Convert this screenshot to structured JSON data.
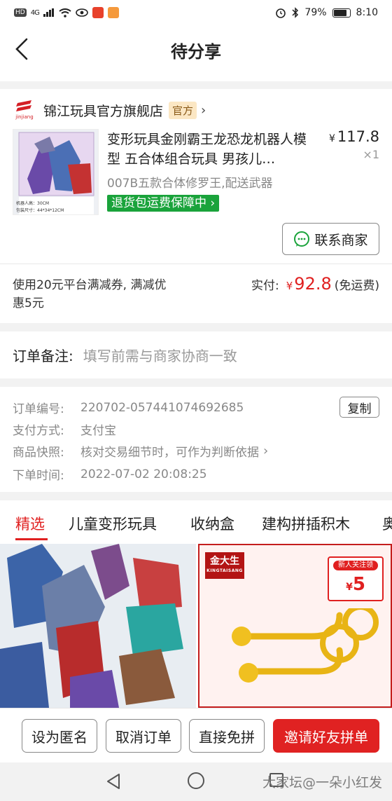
{
  "status_bar": {
    "hd": "HD",
    "network": "4G",
    "battery": "79%",
    "time": "8:10"
  },
  "nav": {
    "title": "待分享"
  },
  "store": {
    "logo_text": "jinjiang",
    "name": "锦江玩具官方旗舰店",
    "badge": "官方"
  },
  "product": {
    "name": "变形玩具金刚霸王龙恐龙机器人模型 五合体组合玩具 男孩儿…",
    "price_symbol": "¥",
    "price": "117.8",
    "quantity": "×1",
    "spec": "007B五款合体修罗王,配送武器",
    "guarantee": "退货包运费保障中",
    "image_caption_1": "机器人高：30CM",
    "image_caption_2": "包装尺寸：44*34*12CM"
  },
  "contact": {
    "label": "联系商家"
  },
  "payment": {
    "coupon_text": "使用20元平台满减券, 满减优惠5元",
    "paid_label": "实付:",
    "currency": "¥",
    "paid_amount": "92.8",
    "shipping": "(免运费)"
  },
  "remark": {
    "label": "订单备注:",
    "placeholder": "填写前需与商家协商一致"
  },
  "order_info": {
    "order_no_label": "订单编号:",
    "order_no": "220702-057441074692685",
    "copy_label": "复制",
    "pay_method_label": "支付方式:",
    "pay_method": "支付宝",
    "snapshot_label": "商品快照:",
    "snapshot_value": "核对交易细节时，可作为判断依据",
    "time_label": "下单时间:",
    "time_value": "2022-07-02 20:08:25"
  },
  "tabs": [
    {
      "label": "精选",
      "active": true
    },
    {
      "label": "儿童变形玩具",
      "active": false
    },
    {
      "label": "收纳盒",
      "active": false
    },
    {
      "label": "建构拼插积木",
      "active": false
    },
    {
      "label": "奥",
      "active": false
    }
  ],
  "recommend": {
    "brand_name": "金大生",
    "brand_sub": "KINGTAISANG",
    "newbie_label": "新人关注领",
    "newbie_currency": "¥",
    "newbie_value": "5"
  },
  "actions": {
    "anonymous": "设为匿名",
    "cancel": "取消订单",
    "direct": "直接免拼",
    "invite": "邀请好友拼单"
  },
  "watermark": "大家坛@一朵小红发",
  "colors": {
    "accent_red": "#e02020",
    "guarantee_green": "#1aa33b",
    "badge_bg": "#fbe7c4"
  }
}
